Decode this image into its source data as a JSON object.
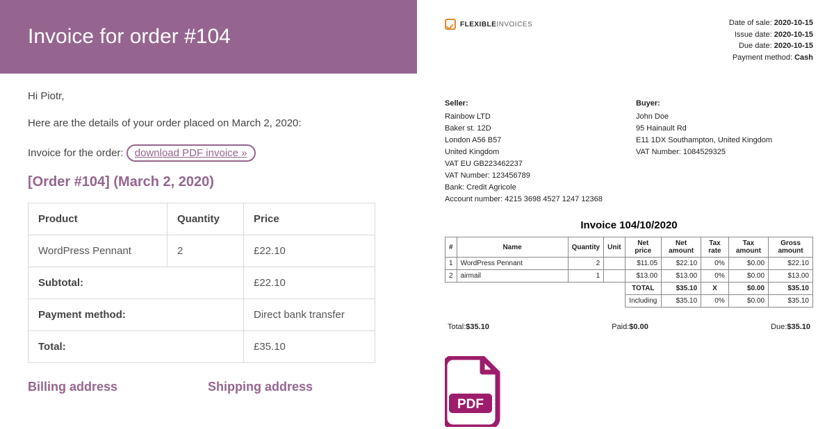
{
  "email": {
    "header": "Invoice for order #104",
    "greeting": "Hi Piotr,",
    "intro": "Here are the details of your order placed on March 2, 2020:",
    "download_prefix": "Invoice for the order: ",
    "download_link": "download PDF invoice »",
    "order_heading": "[Order #104] (March 2, 2020)",
    "table": {
      "headers": {
        "product": "Product",
        "qty": "Quantity",
        "price": "Price"
      },
      "item": {
        "product": "WordPress Pennant",
        "qty": "2",
        "price": "£22.10"
      },
      "subtotal_label": "Subtotal:",
      "subtotal_value": "£22.10",
      "payment_label": "Payment method:",
      "payment_value": "Direct bank transfer",
      "total_label": "Total:",
      "total_value": "£35.10"
    },
    "billing_heading": "Billing address",
    "shipping_heading": "Shipping address"
  },
  "invoice": {
    "logo": {
      "part1": "FLEXIBLE",
      "part2": "INVOICES"
    },
    "meta": {
      "date_of_sale_label": "Date of sale: ",
      "date_of_sale": "2020-10-15",
      "issue_date_label": "Issue date: ",
      "issue_date": "2020-10-15",
      "due_date_label": "Due date: ",
      "due_date": "2020-10-15",
      "payment_method_label": "Payment method: ",
      "payment_method": "Cash"
    },
    "seller": {
      "title": "Seller:",
      "name": "Rainbow LTD",
      "street": "Baker st. 12D",
      "city": "London A56 B57",
      "country": "United Kingdom",
      "vat_eu": "VAT EU GB223462237",
      "vat_no": "VAT Number: 123456789",
      "bank": "Bank: Credit Agricole",
      "account": "Account number: 4215 3698 4527 1247 12368"
    },
    "buyer": {
      "title": "Buyer:",
      "name": "John Doe",
      "street": "95 Hainault Rd",
      "city": "E11 1DX Southampton, United Kingdom",
      "vat_no": "VAT Number: 1084529325"
    },
    "title": "Invoice 104/10/2020",
    "table": {
      "headers": {
        "idx": "#",
        "name": "Name",
        "qty": "Quantity",
        "unit": "Unit",
        "net_price": "Net price",
        "net_amount": "Net amount",
        "tax_rate": "Tax rate",
        "tax_amount": "Tax amount",
        "gross": "Gross amount"
      },
      "rows": [
        {
          "idx": "1",
          "name": "WordPress Pennant",
          "qty": "2",
          "unit": "",
          "net_price": "$11.05",
          "net_amount": "$22.10",
          "tax_rate": "0%",
          "tax_amount": "$0.00",
          "gross": "$22.10"
        },
        {
          "idx": "2",
          "name": "airmail",
          "qty": "1",
          "unit": "",
          "net_price": "$13.00",
          "net_amount": "$13.00",
          "tax_rate": "0%",
          "tax_amount": "$0.00",
          "gross": "$13.00"
        }
      ],
      "total_label": "TOTAL",
      "total_net": "$35.10",
      "total_tax_rate": "X",
      "total_tax_amount": "$0.00",
      "total_gross": "$35.10",
      "including_label": "Including",
      "inc_net": "$35.10",
      "inc_tax_rate": "0%",
      "inc_tax_amount": "$0.00",
      "inc_gross": "$35.10"
    },
    "summary": {
      "total_label": "Total:",
      "total_value": "$35.10",
      "paid_label": "Paid:",
      "paid_value": "$0.00",
      "due_label": "Due:",
      "due_value": "$35.10"
    }
  }
}
